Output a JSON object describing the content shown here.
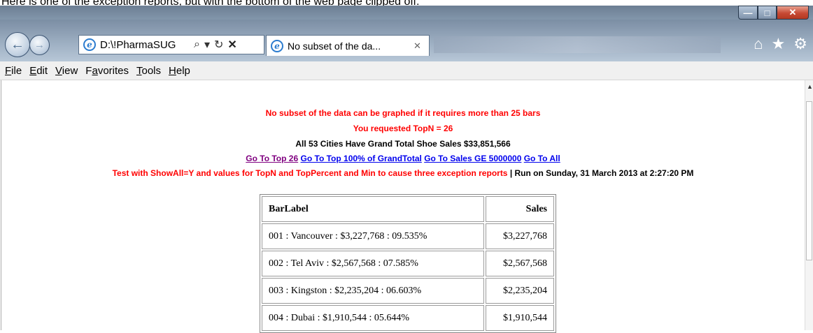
{
  "caption": "Here is one of the exception reports, but with the bottom of the web page clipped off.",
  "window": {
    "min_glyph": "—",
    "max_glyph": "□",
    "close_glyph": "✕"
  },
  "nav": {
    "back_glyph": "←",
    "forward_glyph": "→",
    "address": "D:\\!PharmaSUG",
    "search_glyph": "⌕",
    "dropdown_glyph": "▾",
    "refresh_glyph": "↻",
    "stop_glyph": "✕",
    "tab_title": "No subset of the da...",
    "tab_close_glyph": "✕",
    "home_glyph": "⌂",
    "favorites_glyph": "★",
    "settings_glyph": "⚙"
  },
  "menu": [
    {
      "key": "F",
      "rest": "ile"
    },
    {
      "key": "E",
      "rest": "dit"
    },
    {
      "key": "V",
      "rest": "iew"
    },
    {
      "key": "a",
      "pre": "F",
      "rest": "vorites"
    },
    {
      "key": "T",
      "rest": "ools"
    },
    {
      "key": "H",
      "rest": "elp"
    }
  ],
  "report": {
    "line1": "No subset of the data can be graphed if it requires more than 25 bars",
    "line2": "You requested TopN = 26",
    "line3": "All 53 Cities Have Grand Total Shoe Sales $33,851,566",
    "links": [
      "Go To Top 26",
      "Go To Top 100% of GrandTotal",
      "Go To Sales GE 5000000",
      "Go To All"
    ],
    "test_text": "Test with ShowAll=Y and values for TopN and TopPercent and Min to cause three exception reports",
    "run_text": " | Run on Sunday, 31 March 2013 at 2:27:20 PM"
  },
  "table": {
    "headers": [
      "BarLabel",
      "Sales"
    ],
    "rows": [
      [
        "001 : Vancouver : $3,227,768 : 09.535%",
        "$3,227,768"
      ],
      [
        "002 : Tel Aviv : $2,567,568 : 07.585%",
        "$2,567,568"
      ],
      [
        "003 : Kingston : $2,235,204 : 06.603%",
        "$2,235,204"
      ],
      [
        "004 : Dubai : $1,910,544 : 05.644%",
        "$1,910,544"
      ]
    ]
  }
}
